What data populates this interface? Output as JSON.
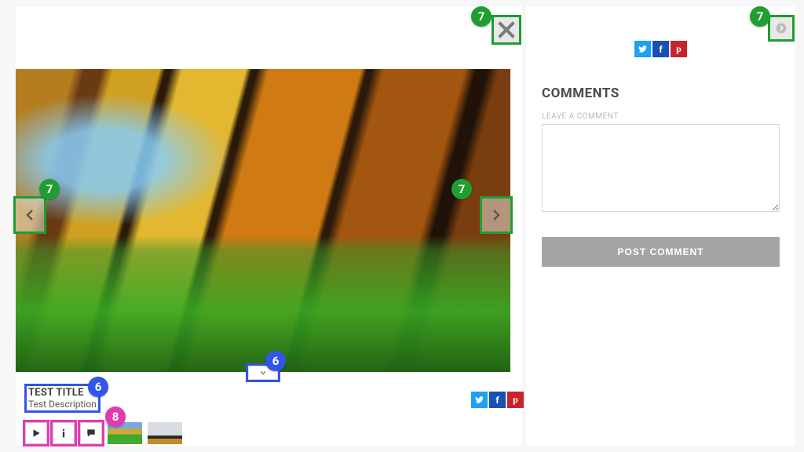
{
  "gallery": {
    "title": "TEST TITLE",
    "description": "Test Description"
  },
  "sidebar": {
    "comments_heading": "COMMENTS",
    "leave_label": "LEAVE A COMMENT",
    "post_button": "POST COMMENT"
  },
  "share": {
    "twitter_glyph": "t",
    "facebook_glyph": "f",
    "pinterest_glyph": "p"
  },
  "annotations": {
    "close": "7",
    "prev": "7",
    "next": "7",
    "collapse": "7",
    "toggle_thumbs": "6",
    "title_block": "6",
    "toolbar": "8"
  }
}
